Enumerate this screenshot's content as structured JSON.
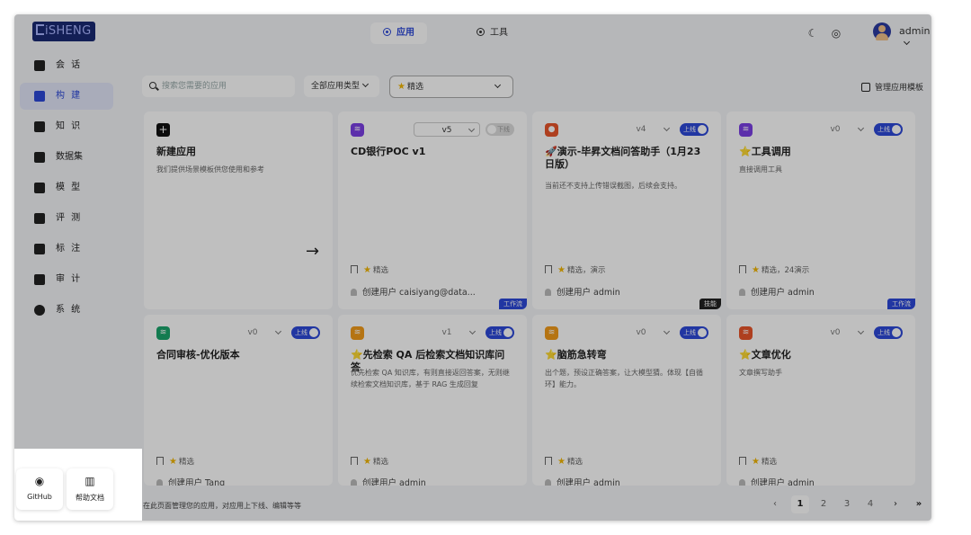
{
  "header": {
    "logo": "iSHENG",
    "tabs": [
      {
        "label": "应用",
        "active": true
      },
      {
        "label": "工具",
        "active": false
      }
    ],
    "icons": [
      "theme-toggle-icon",
      "globe-icon"
    ],
    "user": "admin"
  },
  "sidebar": {
    "items": [
      {
        "label": "会 话",
        "icon": "chat-icon",
        "active": false
      },
      {
        "label": "构 建",
        "icon": "build-icon",
        "active": true
      },
      {
        "label": "知 识",
        "icon": "book-icon",
        "active": false
      },
      {
        "label": "数据集",
        "icon": "dataset-icon",
        "active": false
      },
      {
        "label": "模 型",
        "icon": "model-icon",
        "active": false
      },
      {
        "label": "评 测",
        "icon": "evaluation-icon",
        "active": false
      },
      {
        "label": "标 注",
        "icon": "tag-icon",
        "active": false
      },
      {
        "label": "审 计",
        "icon": "shield-icon",
        "active": false
      },
      {
        "label": "系 统",
        "icon": "gear-icon",
        "active": false
      }
    ]
  },
  "toolbar": {
    "search_placeholder": "搜索您需要的应用",
    "type_select": "全部应用类型",
    "tag_select": "精选",
    "manage_label": "管理应用模板"
  },
  "new_app": {
    "title": "新建应用",
    "desc": "我们提供场景模板供您使用和参考"
  },
  "cards": [
    {
      "title": "CD银行POC v1",
      "desc": "",
      "version": "v5",
      "status": "下线",
      "online": false,
      "tags": "精选",
      "owner": "创建用户 caisiyang@data...",
      "badge": "工作流",
      "icon_color": "#7b3fe4"
    },
    {
      "title": "🚀演示-毕昇文档问答助手（1月23日版）",
      "desc": "当前还不支持上传错误截图，后续会支持。",
      "version": "v4",
      "status": "上线",
      "online": true,
      "tags": "精选，演示",
      "owner": "创建用户 admin",
      "badge": "技能",
      "icon_color": "#e8542a"
    },
    {
      "title": "⭐工具调用",
      "desc": "直接调用工具",
      "version": "v0",
      "status": "上线",
      "online": true,
      "tags": "精选，24演示",
      "owner": "创建用户 admin",
      "badge": "工作流",
      "icon_color": "#7b3fe4"
    },
    {
      "title": "合同审核-优化版本",
      "desc": "",
      "version": "v0",
      "status": "上线",
      "online": true,
      "tags": "精选",
      "owner": "创建用户 Tang",
      "badge": "",
      "icon_color": "#1aa56b"
    },
    {
      "title": "⭐先检索 QA 后检索文档知识库问答",
      "desc": "优先检索 QA 知识库，有则直接返回答案，无则继续检索文档知识库，基于 RAG 生成回复",
      "version": "v1",
      "status": "上线",
      "online": true,
      "tags": "精选",
      "owner": "创建用户 admin",
      "badge": "",
      "icon_color": "#f29b1a"
    },
    {
      "title": "⭐脑筋急转弯",
      "desc": "出个题，预设正确答案，让大模型猜。体现【自循环】能力。",
      "version": "v0",
      "status": "上线",
      "online": true,
      "tags": "精选",
      "owner": "创建用户 admin",
      "badge": "",
      "icon_color": "#f29b1a"
    },
    {
      "title": "⭐文章优化",
      "desc": "文章撰写助手",
      "version": "v0",
      "status": "上线",
      "online": true,
      "tags": "精选",
      "owner": "创建用户 admin",
      "badge": "",
      "icon_color": "#e8542a"
    }
  ],
  "popup": {
    "github": "GitHub",
    "docs": "帮助文档"
  },
  "footer": {
    "note": "在此页面管理您的应用，对应用上下线、编辑等等",
    "pages": [
      "1",
      "2",
      "3",
      "4"
    ],
    "current_page": 1
  }
}
